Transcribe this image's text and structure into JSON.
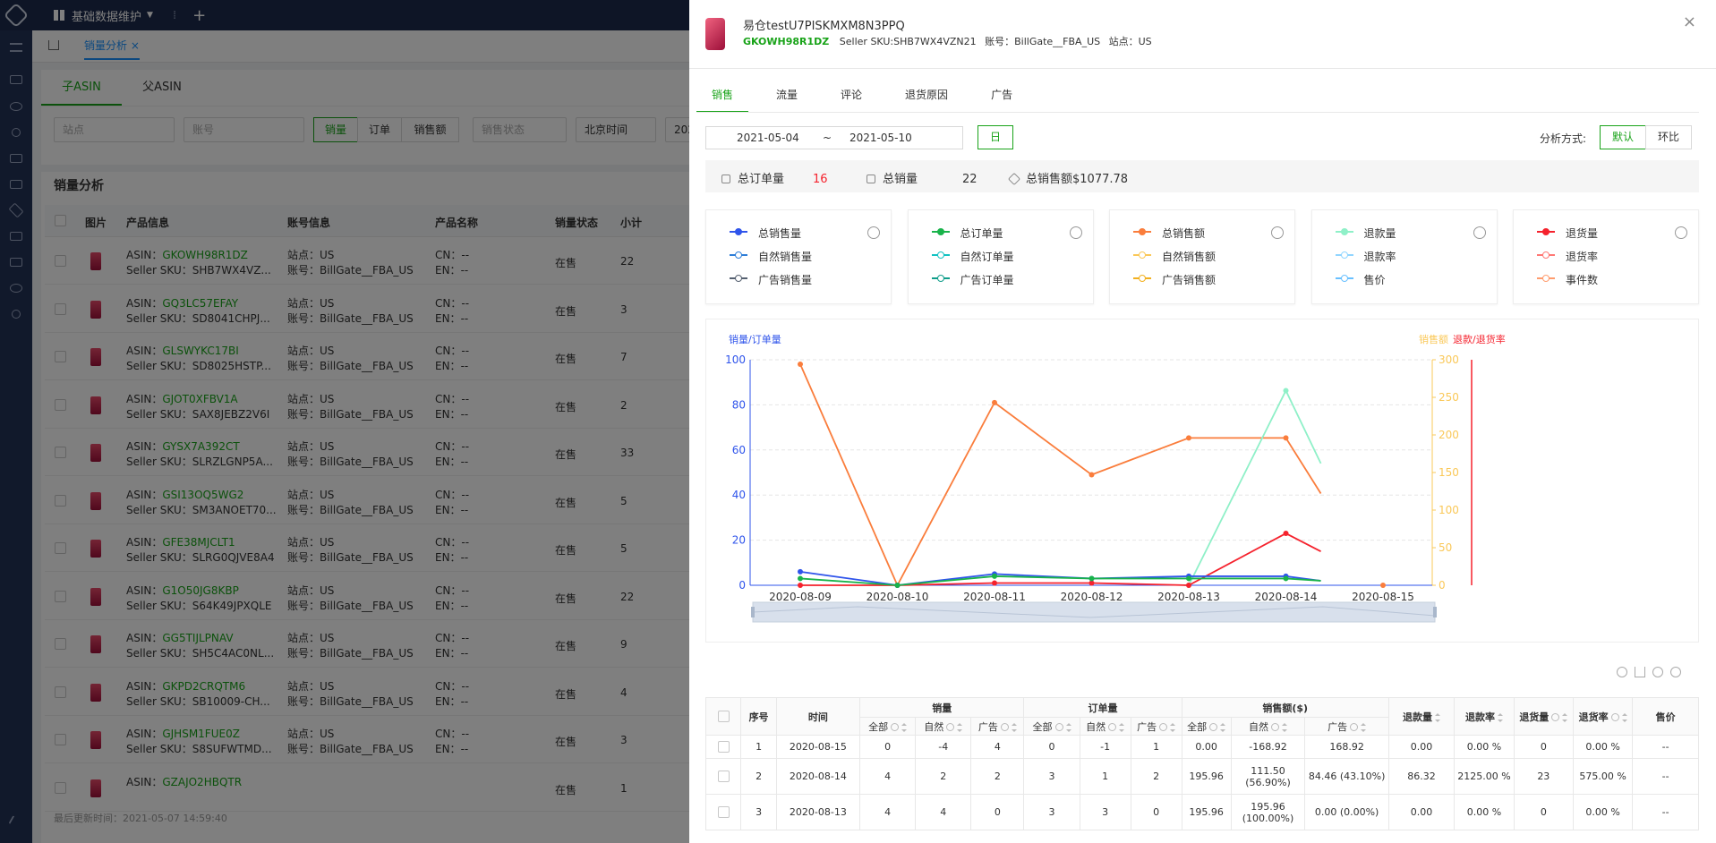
{
  "app": {
    "menu_label": "基础数据维护",
    "add_tab": "+",
    "divider": "⁞"
  },
  "tabs": [
    {
      "label": "销量分析"
    }
  ],
  "subtabs": [
    "子ASIN",
    "父ASIN"
  ],
  "filters": {
    "site_placeholder": "站点",
    "account_placeholder": "账号",
    "metric_buttons": [
      "销量",
      "订单",
      "销售额"
    ],
    "sale_status_placeholder": "销售状态",
    "timezone": "北京时间",
    "date_prefix": "202"
  },
  "section_title": "销量分析",
  "bg_table": {
    "headers": [
      "图片",
      "产品信息",
      "账号信息",
      "产品名称",
      "销量状态",
      "小计"
    ],
    "rows": [
      {
        "asin": "GKOWH98R1DZ",
        "sku": "SHB7WX4VZ...",
        "site": "US",
        "account": "BillGate__FBA_US",
        "cn": "--",
        "en": "--",
        "status": "在售",
        "subtotal": "22"
      },
      {
        "asin": "GQ3LC57EFAY",
        "sku": "SD8041CHPJ...",
        "site": "US",
        "account": "BillGate__FBA_US",
        "cn": "--",
        "en": "--",
        "status": "在售",
        "subtotal": "3"
      },
      {
        "asin": "GLSWYKC17BI",
        "sku": "SD8025HSTP...",
        "site": "US",
        "account": "BillGate__FBA_US",
        "cn": "--",
        "en": "--",
        "status": "在售",
        "subtotal": "7"
      },
      {
        "asin": "GJOT0XFBV1A",
        "sku": "SAX8JEBZ2V6I",
        "site": "US",
        "account": "BillGate__FBA_US",
        "cn": "--",
        "en": "--",
        "status": "在售",
        "subtotal": "2"
      },
      {
        "asin": "GYSX7A392CT",
        "sku": "SLRZLGNP5A...",
        "site": "US",
        "account": "BillGate__FBA_US",
        "cn": "--",
        "en": "--",
        "status": "在售",
        "subtotal": "33"
      },
      {
        "asin": "GSI13OQ5WG2",
        "sku": "SM3ANOET70...",
        "site": "US",
        "account": "BillGate__FBA_US",
        "cn": "--",
        "en": "--",
        "status": "在售",
        "subtotal": "5"
      },
      {
        "asin": "GFE38MJCLT1",
        "sku": "SLRG0QJVE8A4",
        "site": "US",
        "account": "BillGate__FBA_US",
        "cn": "--",
        "en": "--",
        "status": "在售",
        "subtotal": "5"
      },
      {
        "asin": "G1O50JG8KBP",
        "sku": "S64K49JPXQLE",
        "site": "US",
        "account": "BillGate__FBA_US",
        "cn": "--",
        "en": "--",
        "status": "在售",
        "subtotal": "22"
      },
      {
        "asin": "GG5TIJLPNAV",
        "sku": "SH5C4AC0NL...",
        "site": "US",
        "account": "BillGate__FBA_US",
        "cn": "--",
        "en": "--",
        "status": "在售",
        "subtotal": "9"
      },
      {
        "asin": "GKPD2CRQTM6",
        "sku": "SB10009-CH...",
        "site": "US",
        "account": "BillGate__FBA_US",
        "cn": "--",
        "en": "--",
        "status": "在售",
        "subtotal": "4"
      },
      {
        "asin": "GJHSM1FUE0Z",
        "sku": "S8SUFWTMD...",
        "site": "US",
        "account": "BillGate__FBA_US",
        "cn": "--",
        "en": "--",
        "status": "在售",
        "subtotal": "3"
      },
      {
        "asin": "GZAJO2HBQTR",
        "sku": "",
        "site": "",
        "account": "",
        "cn": "",
        "en": "",
        "status": "在售",
        "subtotal": "1"
      }
    ],
    "labels": {
      "asin": "ASIN：",
      "sku": "Seller SKU：",
      "site": "站点：",
      "account": "账号：",
      "cn": "CN：",
      "en": "EN："
    }
  },
  "last_update": "最后更新时间：2021-05-07 14:59:40",
  "drawer": {
    "title": "易仓testU7PISKMXM8N3PPQ",
    "asin": "GKOWH98R1DZ",
    "seller_sku": "Seller SKU:SHB7WX4VZN21",
    "account": "账号：BillGate__FBA_US",
    "site": "站点：US",
    "close": "×",
    "tabs": [
      "销售",
      "流量",
      "评论",
      "退货原因",
      "广告"
    ],
    "date_start": "2021-05-04",
    "date_sep": "~",
    "date_end": "2021-05-10",
    "day_button": "日",
    "analysis_label": "分析方式:",
    "analysis_options": [
      "默认",
      "环比"
    ],
    "summary": [
      {
        "label": "总订单量",
        "value": "16",
        "color": "#f5222d"
      },
      {
        "label": "总销量",
        "value": "22",
        "color": "#333333"
      },
      {
        "label": "总销售额",
        "value": "$1077.78",
        "color": "#333333"
      }
    ],
    "metric_cards": [
      {
        "items": [
          {
            "label": "总销售量",
            "color": "#2f54eb",
            "filled": true
          },
          {
            "label": "自然销售量",
            "color": "#2f7ed8",
            "filled": false
          },
          {
            "label": "广告销售量",
            "color": "#556070",
            "filled": false
          }
        ]
      },
      {
        "items": [
          {
            "label": "总订单量",
            "color": "#19b34a",
            "filled": true
          },
          {
            "label": "自然订单量",
            "color": "#13c2c2",
            "filled": false
          },
          {
            "label": "广告订单量",
            "color": "#0f9d8a",
            "filled": false
          }
        ]
      },
      {
        "items": [
          {
            "label": "总销售额",
            "color": "#fa7d3c",
            "filled": true
          },
          {
            "label": "自然销售额",
            "color": "#fac858",
            "filled": false
          },
          {
            "label": "广告销售额",
            "color": "#f2b01e",
            "filled": false
          }
        ]
      },
      {
        "items": [
          {
            "label": "退款量",
            "color": "#8ff0c8",
            "filled": true
          },
          {
            "label": "退款率",
            "color": "#91d5ff",
            "filled": false
          },
          {
            "label": "售价",
            "color": "#69c0ff",
            "filled": false
          }
        ]
      },
      {
        "items": [
          {
            "label": "退货量",
            "color": "#f5222d",
            "filled": true
          },
          {
            "label": "退货率",
            "color": "#ff7875",
            "filled": false
          },
          {
            "label": "事件数",
            "color": "#ff9c6e",
            "filled": false
          }
        ]
      }
    ]
  },
  "chart_data": {
    "type": "line",
    "categories": [
      "2020-08-09",
      "2020-08-10",
      "2020-08-11",
      "2020-08-12",
      "2020-08-13",
      "2020-08-14",
      "2020-08-15"
    ],
    "ylabel_left": "销量/订单量",
    "ylabel_right_1": "销售额",
    "ylabel_right_2": "退款/退货率",
    "ylim_left": [
      0,
      100
    ],
    "ylim_right": [
      0,
      300
    ],
    "yticks_left": [
      "0",
      "20",
      "40",
      "60",
      "80",
      "100"
    ],
    "yticks_right": [
      "0",
      "50",
      "100",
      "150",
      "200",
      "250",
      "300"
    ],
    "series": [
      {
        "name": "总销售额",
        "axis": "right",
        "color": "#fa7d3c",
        "values": [
          294,
          0,
          243,
          147,
          196,
          196,
          122
        ],
        "last_x": 5.36
      },
      {
        "name": "退款量",
        "axis": "left",
        "color": "#8ff0c8",
        "values": [
          null,
          null,
          null,
          null,
          0,
          86.32,
          54
        ],
        "last_x": 5.36,
        "start_x": 3.95
      },
      {
        "name": "退货量",
        "axis": "left",
        "color": "#f5222d",
        "values": [
          0,
          0,
          1,
          1,
          0,
          23,
          15
        ],
        "last_x": 5.36
      },
      {
        "name": "总销售量",
        "axis": "left",
        "color": "#2f54eb",
        "values": [
          6,
          0,
          5,
          3,
          4,
          4,
          2
        ],
        "last_x": 5.36
      },
      {
        "name": "总订单量",
        "axis": "left",
        "color": "#19b34a",
        "values": [
          3,
          0,
          4,
          3,
          3,
          3,
          2
        ],
        "last_x": 5.36
      }
    ],
    "extra_point": {
      "x": "2020-08-15",
      "value": 0,
      "color": "#fa7d3c"
    }
  },
  "detail_table": {
    "group_headers": [
      "序号",
      "时间",
      "销量",
      "订单量",
      "销售额($)",
      "退款量",
      "退款率",
      "退货量",
      "退货率",
      "售价"
    ],
    "sub_headers": [
      "全部",
      "自然",
      "广告",
      "全部",
      "自然",
      "广告",
      "全部",
      "自然",
      "广告"
    ],
    "rows": [
      {
        "no": "1",
        "date": "2020-08-15",
        "s_all": "0",
        "s_nat": "-4",
        "s_ad": "4",
        "o_all": "0",
        "o_nat": "-1",
        "o_ad": "1",
        "r_all": "0.00",
        "r_nat": "-168.92",
        "r_ad": "168.92",
        "refund": "0.00",
        "refund_rate": "0.00 %",
        "ret": "0",
        "ret_rate": "0.00 %",
        "price": "--"
      },
      {
        "no": "2",
        "date": "2020-08-14",
        "s_all": "4",
        "s_nat": "2",
        "s_ad": "2",
        "o_all": "3",
        "o_nat": "1",
        "o_ad": "2",
        "r_all": "195.96",
        "r_nat": "111.50 (56.90%)",
        "r_ad": "84.46 (43.10%)",
        "refund": "86.32",
        "refund_rate": "2125.00 %",
        "ret": "23",
        "ret_rate": "575.00 %",
        "price": "--"
      },
      {
        "no": "3",
        "date": "2020-08-13",
        "s_all": "4",
        "s_nat": "4",
        "s_ad": "0",
        "o_all": "3",
        "o_nat": "3",
        "o_ad": "0",
        "r_all": "195.96",
        "r_nat": "195.96 (100.00%)",
        "r_ad": "0.00 (0.00%)",
        "refund": "0.00",
        "refund_rate": "0.00 %",
        "ret": "0",
        "ret_rate": "0.00 %",
        "price": "--"
      }
    ]
  }
}
